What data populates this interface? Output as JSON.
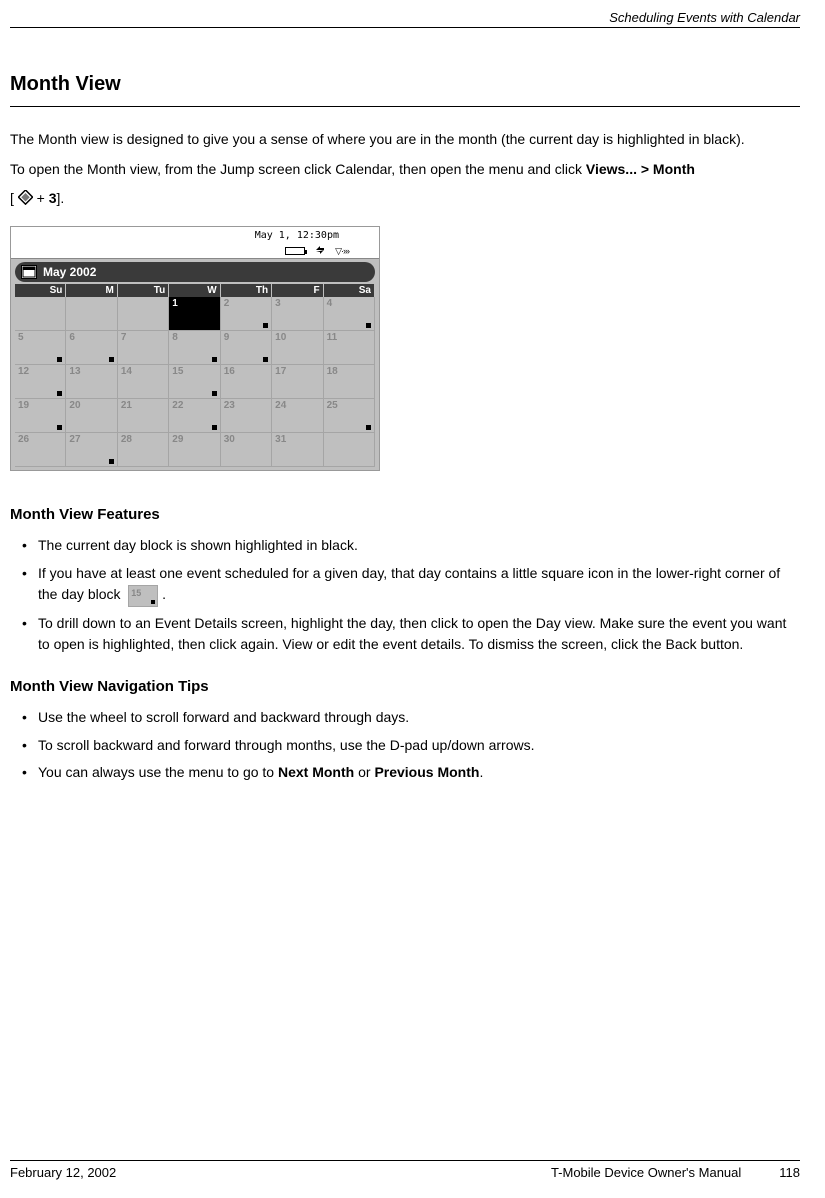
{
  "header": {
    "section": "Scheduling Events with Calendar"
  },
  "title": "Month View",
  "intro": "The Month view is designed to give you a sense of where you are in the month (the current day is highlighted in black).",
  "open_instruction_prefix": "To open the Month view, from the Jump screen click Calendar, then open the menu and click ",
  "open_instruction_bold": "Views... > Month",
  "shortcut": {
    "open": "[",
    "plus": " + ",
    "key": "3",
    "close": "]."
  },
  "calendar": {
    "status_time": "May 1, 12:30pm",
    "month_label": "May 2002",
    "day_headers": [
      "Su",
      "M",
      "Tu",
      "W",
      "Th",
      "F",
      "Sa"
    ],
    "cells": [
      {
        "n": "",
        "dot": false,
        "current": false
      },
      {
        "n": "",
        "dot": false,
        "current": false
      },
      {
        "n": "",
        "dot": false,
        "current": false
      },
      {
        "n": "1",
        "dot": true,
        "current": true
      },
      {
        "n": "2",
        "dot": true,
        "current": false
      },
      {
        "n": "3",
        "dot": false,
        "current": false
      },
      {
        "n": "4",
        "dot": true,
        "current": false
      },
      {
        "n": "5",
        "dot": true,
        "current": false
      },
      {
        "n": "6",
        "dot": true,
        "current": false
      },
      {
        "n": "7",
        "dot": false,
        "current": false
      },
      {
        "n": "8",
        "dot": true,
        "current": false
      },
      {
        "n": "9",
        "dot": true,
        "current": false
      },
      {
        "n": "10",
        "dot": false,
        "current": false
      },
      {
        "n": "11",
        "dot": false,
        "current": false
      },
      {
        "n": "12",
        "dot": true,
        "current": false
      },
      {
        "n": "13",
        "dot": false,
        "current": false
      },
      {
        "n": "14",
        "dot": false,
        "current": false
      },
      {
        "n": "15",
        "dot": true,
        "current": false
      },
      {
        "n": "16",
        "dot": false,
        "current": false
      },
      {
        "n": "17",
        "dot": false,
        "current": false
      },
      {
        "n": "18",
        "dot": false,
        "current": false
      },
      {
        "n": "19",
        "dot": true,
        "current": false
      },
      {
        "n": "20",
        "dot": false,
        "current": false
      },
      {
        "n": "21",
        "dot": false,
        "current": false
      },
      {
        "n": "22",
        "dot": true,
        "current": false
      },
      {
        "n": "23",
        "dot": false,
        "current": false
      },
      {
        "n": "24",
        "dot": false,
        "current": false
      },
      {
        "n": "25",
        "dot": true,
        "current": false
      },
      {
        "n": "26",
        "dot": false,
        "current": false
      },
      {
        "n": "27",
        "dot": true,
        "current": false
      },
      {
        "n": "28",
        "dot": false,
        "current": false
      },
      {
        "n": "29",
        "dot": false,
        "current": false
      },
      {
        "n": "30",
        "dot": false,
        "current": false
      },
      {
        "n": "31",
        "dot": false,
        "current": false
      },
      {
        "n": "",
        "dot": false,
        "current": false
      }
    ]
  },
  "features_heading": "Month View Features",
  "features": [
    "The current day block is shown highlighted in black.",
    "If you have at least one event scheduled for a given day, that day contains a little square icon in the lower-right corner of the day block",
    "To drill down to an Event Details screen, highlight the day, then click to open the Day view. Make sure the event you want to open is highlighted, then click again. View or edit the event details. To dismiss the screen, click the Back button."
  ],
  "day_block_example_num": "15",
  "tips_heading": "Month View Navigation Tips",
  "tips": [
    {
      "text": "Use the wheel to scroll forward and backward through days."
    },
    {
      "text": "To scroll backward and forward through months, use the D-pad up/down arrows."
    },
    {
      "prefix": "You can always use the menu to go to ",
      "b1": "Next Month",
      "mid": " or ",
      "b2": "Previous Month",
      "suffix": "."
    }
  ],
  "footer": {
    "date": "February 12, 2002",
    "manual": "T-Mobile Device Owner's Manual",
    "page": "118"
  }
}
